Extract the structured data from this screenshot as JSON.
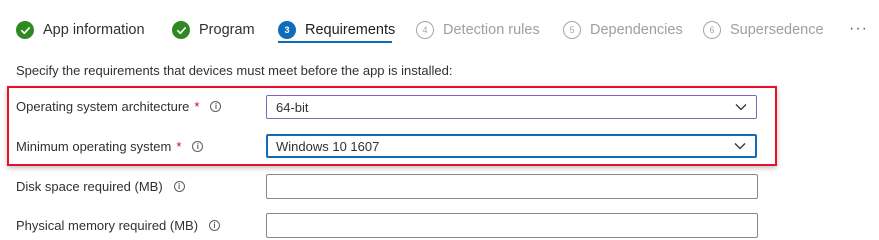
{
  "wizard": {
    "steps": [
      {
        "label": "App information",
        "state": "complete",
        "icon": "checkmark-icon"
      },
      {
        "label": "Program",
        "state": "complete",
        "icon": "checkmark-icon"
      },
      {
        "label": "Requirements",
        "state": "current",
        "number": "3"
      },
      {
        "label": "Detection rules",
        "state": "pending",
        "number": "4"
      },
      {
        "label": "Dependencies",
        "state": "pending",
        "number": "5"
      },
      {
        "label": "Supersedence",
        "state": "pending",
        "number": "6"
      }
    ],
    "more_label": "···"
  },
  "main": {
    "description": "Specify the requirements that devices must meet before the app is installed:",
    "fields": {
      "os_architecture": {
        "label": "Operating system architecture",
        "required_mark": "*",
        "value": "64-bit"
      },
      "min_os": {
        "label": "Minimum operating system",
        "required_mark": "*",
        "value": "Windows 10 1607"
      },
      "disk_space": {
        "label": "Disk space required (MB)",
        "value": ""
      },
      "physical_memory": {
        "label": "Physical memory required (MB)",
        "value": ""
      }
    },
    "info_glyph": "i"
  },
  "colors": {
    "complete_green": "#2e8a20",
    "accent_blue": "#0f6cbd",
    "highlight_red": "#e8112d",
    "required_red": "#c50f1f"
  }
}
